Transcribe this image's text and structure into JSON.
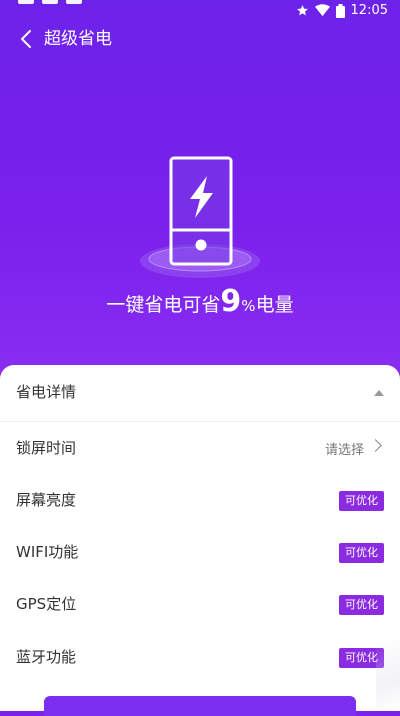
{
  "status_bar": {
    "time": "12:05",
    "icons": [
      "star-icon",
      "wifi-icon",
      "battery-icon"
    ]
  },
  "header": {
    "back_icon": "chevron-left-icon",
    "title": "超级省电"
  },
  "hero": {
    "savings_prefix": "一键省电可省",
    "savings_value": "9",
    "savings_unit": "%",
    "savings_suffix": "电量",
    "icon": "phone-battery-bolt-icon"
  },
  "details": {
    "title": "省电详情",
    "collapse_icon": "triangle-up-icon",
    "rows": [
      {
        "label": "锁屏时间",
        "value": "请选择",
        "type": "select"
      },
      {
        "label": "屏幕亮度",
        "badge": "可优化",
        "type": "badge"
      },
      {
        "label": "WIFI功能",
        "badge": "可优化",
        "type": "badge"
      },
      {
        "label": "GPS定位",
        "badge": "可优化",
        "type": "badge"
      },
      {
        "label": "蓝牙功能",
        "badge": "可优化",
        "type": "badge"
      }
    ]
  },
  "colors": {
    "hero_gradient_top": "#6d22ea",
    "hero_gradient_bottom": "#8a2ef2",
    "badge": "#8a2be2",
    "text_primary": "#333333",
    "text_secondary": "#777777"
  }
}
